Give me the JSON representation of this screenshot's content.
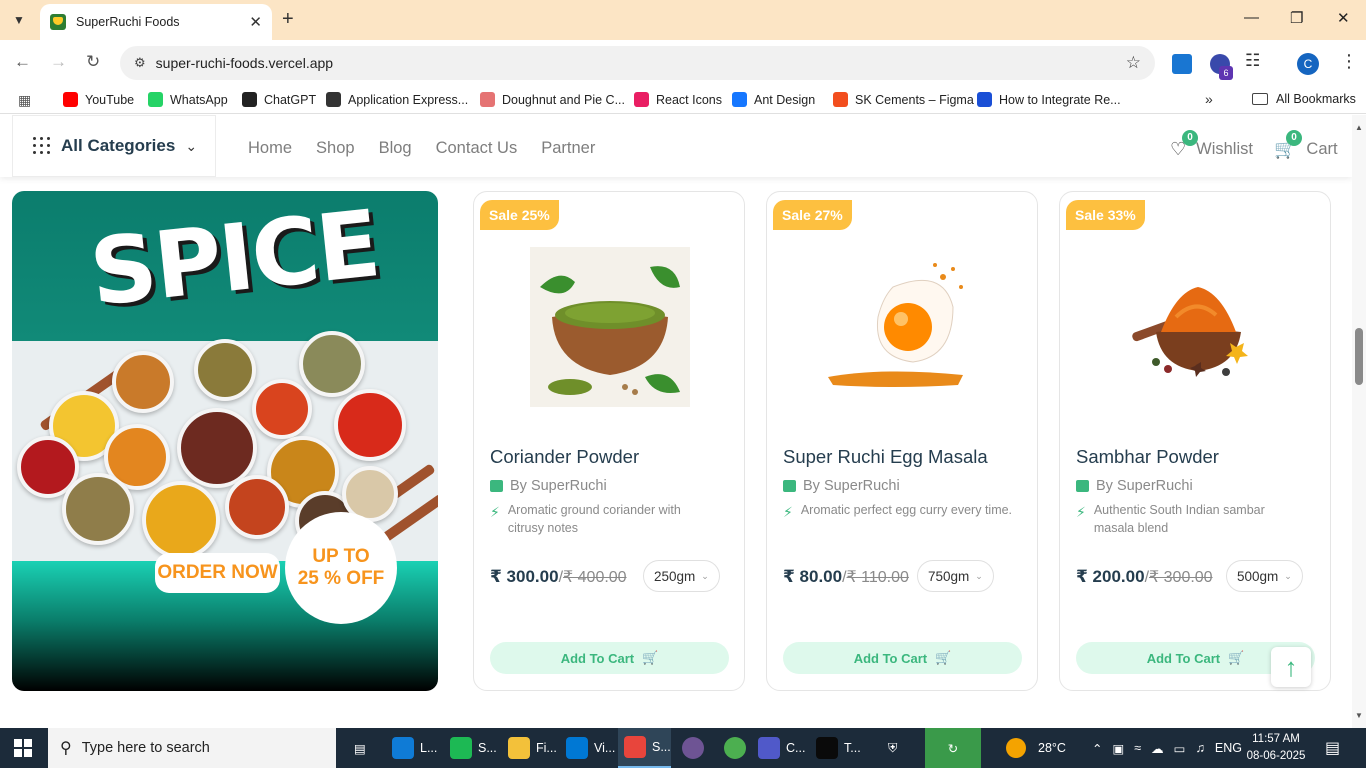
{
  "browser": {
    "tab_title": "SuperRuchi Foods",
    "url": "super-ruchi-foods.vercel.app",
    "ext_badge": "6",
    "profile_initial": "C",
    "bookmarks": [
      {
        "label": "YouTube",
        "color": "#ff0000"
      },
      {
        "label": "WhatsApp",
        "color": "#25d366"
      },
      {
        "label": "ChatGPT",
        "color": "#222222"
      },
      {
        "label": "Application Express...",
        "color": "#333333"
      },
      {
        "label": "Doughnut and Pie C...",
        "color": "#e57373"
      },
      {
        "label": "React Icons",
        "color": "#e91e63"
      },
      {
        "label": "Ant Design",
        "color": "#1677ff"
      },
      {
        "label": "SK Cements – Figma",
        "color": "#f24e1e"
      },
      {
        "label": "How to Integrate Re...",
        "color": "#1a4fd6"
      }
    ],
    "all_bookmarks": "All Bookmarks"
  },
  "header": {
    "categories_label": "All Categories",
    "nav": [
      "Home",
      "Shop",
      "Blog",
      "Contact Us",
      "Partner"
    ],
    "wishlist_label": "Wishlist",
    "wishlist_count": "0",
    "cart_label": "Cart",
    "cart_count": "0"
  },
  "banner": {
    "title": "SPICE",
    "cta": "ORDER NOW",
    "offer_line1": "UP TO",
    "offer_line2": "25 % OFF"
  },
  "products": [
    {
      "sale": "Sale 25%",
      "name": "Coriander Powder",
      "by": "By SuperRuchi",
      "desc": "Aromatic ground coriander with citrusy notes",
      "price": "₹ 300.00",
      "old_price": "₹ 400.00",
      "weight": "250gm",
      "add_to_cart": "Add To Cart"
    },
    {
      "sale": "Sale 27%",
      "name": "Super Ruchi Egg Masala",
      "by": "By SuperRuchi",
      "desc": "Aromatic perfect egg curry every time.",
      "price": "₹ 80.00",
      "old_price": "₹ 110.00",
      "weight": "750gm",
      "add_to_cart": "Add To Cart"
    },
    {
      "sale": "Sale 33%",
      "name": "Sambhar Powder",
      "by": "By SuperRuchi",
      "desc": "Authentic South Indian sambar masala blend",
      "price": "₹ 200.00",
      "old_price": "₹ 300.00",
      "weight": "500gm",
      "add_to_cart": "Add To Cart"
    }
  ],
  "taskbar": {
    "search_placeholder": "Type here to search",
    "apps": [
      {
        "label": "L...",
        "color": "#0f7bd6"
      },
      {
        "label": "S...",
        "color": "#1db954"
      },
      {
        "label": "Fi...",
        "color": "#f3c13a"
      },
      {
        "label": "Vi...",
        "color": "#0078d4"
      },
      {
        "label": "S...",
        "color": "#e8453c"
      },
      {
        "label": "C...",
        "color": "#5059c9"
      },
      {
        "label": "T...",
        "color": "#0a0a0a"
      }
    ],
    "weather": "28°C",
    "lang": "ENG",
    "time": "11:57 AM",
    "date": "08-06-2025"
  }
}
